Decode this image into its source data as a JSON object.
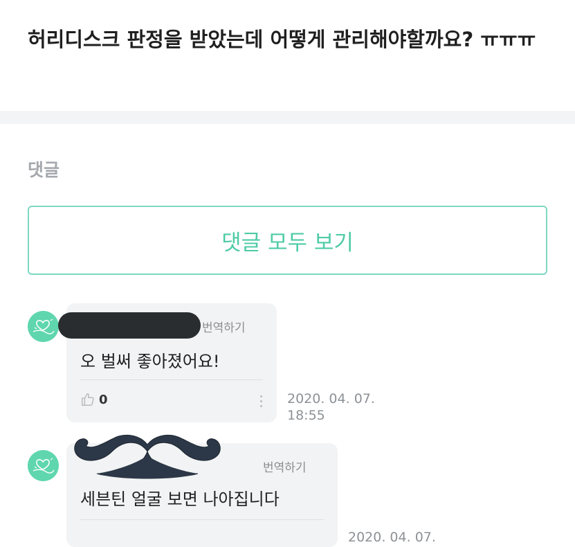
{
  "post": {
    "title": "허리디스크 판정을 받았는데 어떻게 관리해야할까요? ㅠㅠㅠ"
  },
  "comments_section": {
    "label": "댓글",
    "view_all_button": "댓글 모두 보기"
  },
  "comments": [
    {
      "translate_label": "번역하기",
      "text": "오 벌써 좋아졌어요!",
      "like_count": "0",
      "timestamp_date": "2020. 04. 07.",
      "timestamp_time": "18:55"
    },
    {
      "translate_label": "번역하기",
      "text": "세븐틴 얼굴 보면 나아집니다",
      "timestamp_date": "2020. 04. 07."
    }
  ],
  "colors": {
    "accent": "#4fcba6",
    "accent_border": "#7ed8c2",
    "avatar": "#5fd6ae",
    "bubble": "#f2f3f4"
  },
  "icons": [
    "thumbs-up-icon",
    "kebab-menu-icon",
    "heart-doodle-avatar-icon"
  ]
}
